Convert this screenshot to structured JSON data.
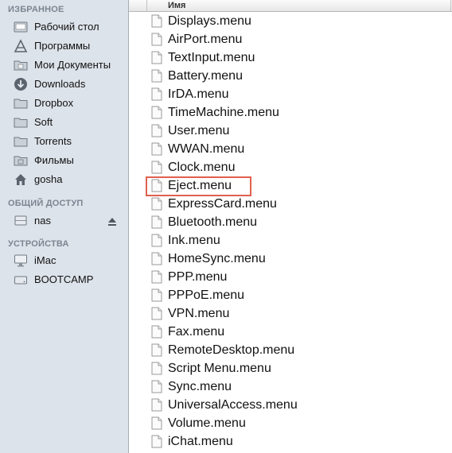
{
  "sidebar": {
    "favorites_title": "ИЗБРАННОЕ",
    "favorites": [
      {
        "label": "Рабочий стол",
        "icon": "desktop-folder-icon"
      },
      {
        "label": "Программы",
        "icon": "applications-icon"
      },
      {
        "label": "Мои Документы",
        "icon": "documents-folder-icon"
      },
      {
        "label": "Downloads",
        "icon": "downloads-icon"
      },
      {
        "label": "Dropbox",
        "icon": "folder-icon"
      },
      {
        "label": "Soft",
        "icon": "folder-icon"
      },
      {
        "label": "Torrents",
        "icon": "folder-icon"
      },
      {
        "label": "Фильмы",
        "icon": "movies-folder-icon"
      },
      {
        "label": "gosha",
        "icon": "home-icon"
      }
    ],
    "shared_title": "ОБЩИЙ ДОСТУП",
    "shared": [
      {
        "label": "nas",
        "icon": "server-icon"
      }
    ],
    "devices_title": "УСТРОЙСТВА",
    "devices": [
      {
        "label": "iMac",
        "icon": "imac-icon"
      },
      {
        "label": "BOOTCAMP",
        "icon": "drive-icon"
      }
    ]
  },
  "list": {
    "column_name": "Имя",
    "files": [
      "Displays.menu",
      "AirPort.menu",
      "TextInput.menu",
      "Battery.menu",
      "IrDA.menu",
      "TimeMachine.menu",
      "User.menu",
      "WWAN.menu",
      "Clock.menu",
      "Eject.menu",
      "ExpressCard.menu",
      "Bluetooth.menu",
      "Ink.menu",
      "HomeSync.menu",
      "PPP.menu",
      "PPPoE.menu",
      "VPN.menu",
      "Fax.menu",
      "RemoteDesktop.menu",
      "Script Menu.menu",
      "Sync.menu",
      "UniversalAccess.menu",
      "Volume.menu",
      "iChat.menu"
    ],
    "highlighted_file": "Eject.menu",
    "highlight_color": "#e0604e"
  }
}
